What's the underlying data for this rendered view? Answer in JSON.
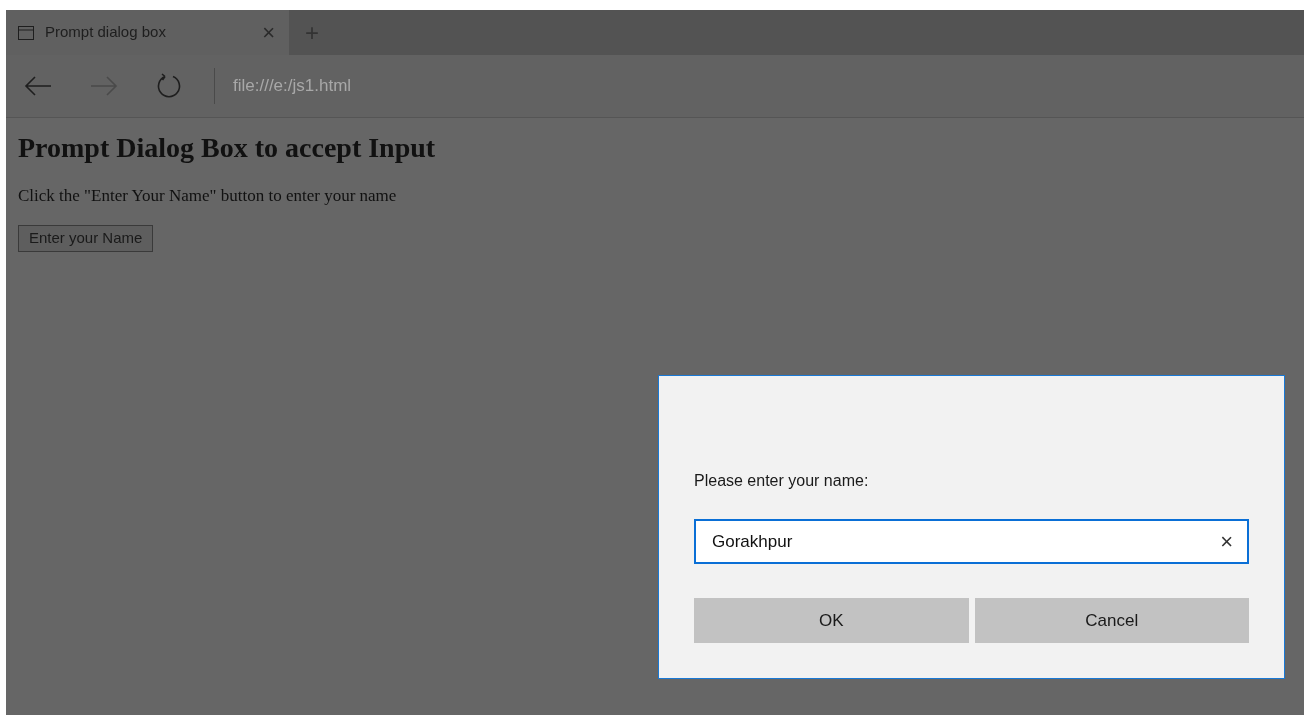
{
  "browser": {
    "tab": {
      "title": "Prompt dialog box",
      "close": "×",
      "selected": true
    },
    "new_tab": "+",
    "address": "file:///e:/js1.html"
  },
  "page": {
    "heading": "Prompt Dialog Box to accept Input",
    "text": "Click the \"Enter Your Name\" button to enter your name",
    "button": "Enter your Name"
  },
  "dialog": {
    "message": "Please enter your name:",
    "value": "Gorakhpur",
    "clear": "×",
    "buttons": [
      "OK",
      "Cancel"
    ]
  }
}
